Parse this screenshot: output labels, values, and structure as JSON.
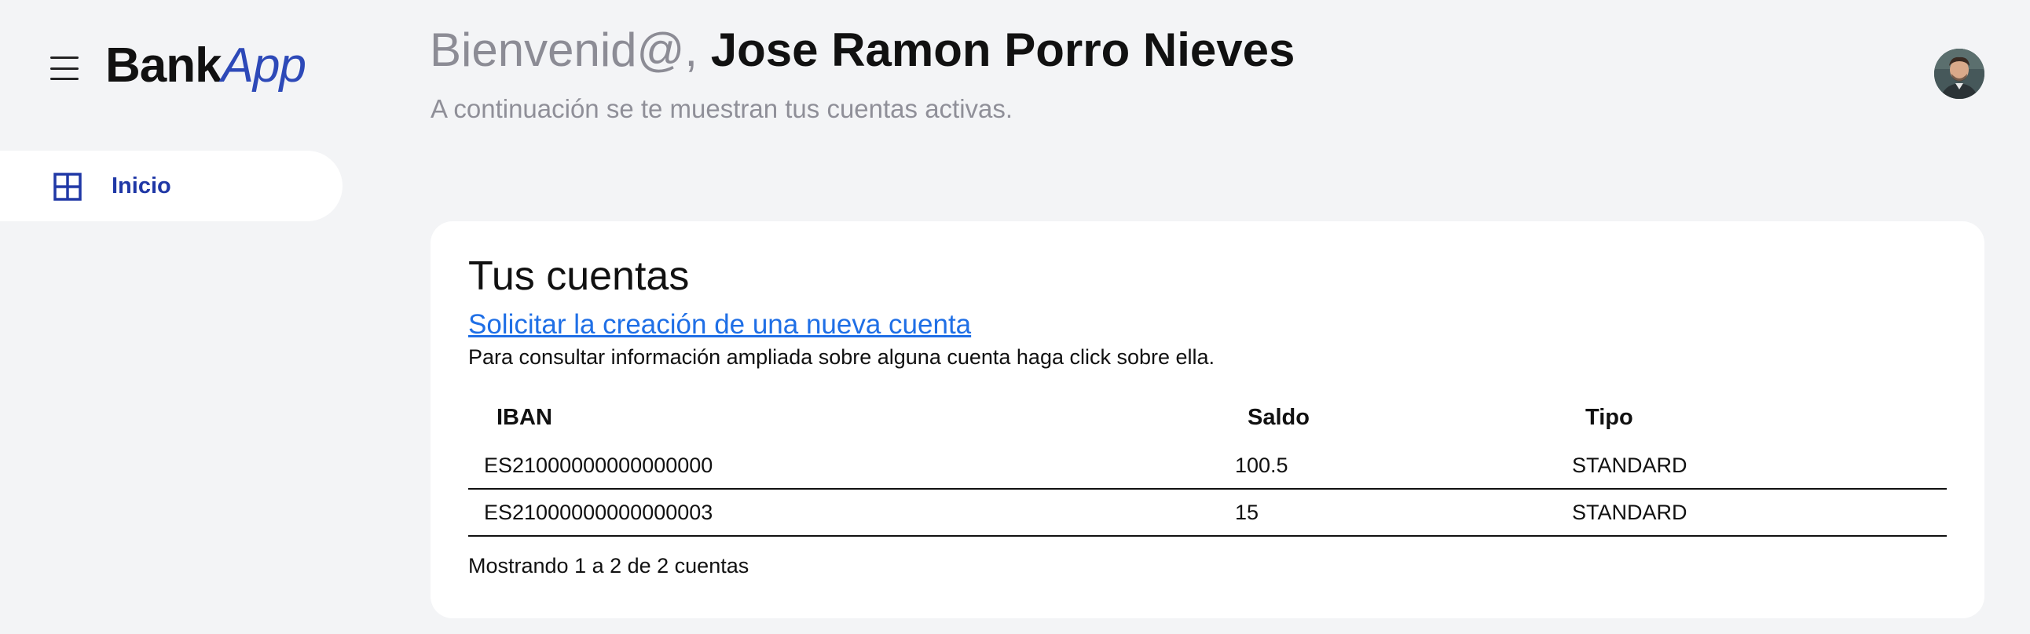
{
  "app": {
    "logo_part1": "Bank",
    "logo_part2": "App"
  },
  "sidebar": {
    "items": [
      {
        "label": "Inicio",
        "icon": "grid-icon"
      }
    ]
  },
  "header": {
    "greeting_prefix": "Bienvenid@,",
    "user_name": "Jose Ramon Porro Nieves",
    "subtitle": "A continuación se te muestran tus cuentas activas."
  },
  "accounts_card": {
    "title": "Tus cuentas",
    "new_account_link": "Solicitar la creación de una nueva cuenta",
    "hint": "Para consultar información ampliada sobre alguna cuenta haga click sobre ella.",
    "columns": [
      "IBAN",
      "Saldo",
      "Tipo"
    ],
    "rows": [
      {
        "iban": "ES21000000000000000",
        "saldo": "100.5",
        "tipo": "STANDARD"
      },
      {
        "iban": "ES21000000000000003",
        "saldo": "15",
        "tipo": "STANDARD"
      }
    ],
    "footer": "Mostrando 1 a 2 de 2 cuentas"
  },
  "colors": {
    "accent": "#2d49b8",
    "nav_active": "#2038a6",
    "link": "#1f6fe6",
    "background": "#f3f4f6"
  }
}
